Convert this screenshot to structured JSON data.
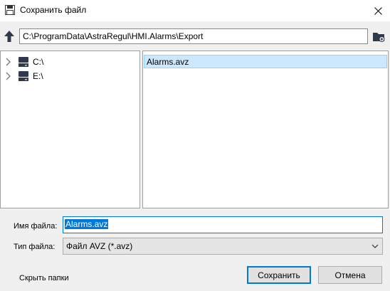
{
  "window": {
    "title": "Сохранить файл"
  },
  "path": {
    "value": "C:\\ProgramData\\AstraRegul\\HMI.Alarms\\Export"
  },
  "tree": {
    "items": [
      {
        "label": "C:\\"
      },
      {
        "label": "E:\\"
      }
    ]
  },
  "files": {
    "items": [
      {
        "name": "Alarms.avz",
        "selected": true
      }
    ]
  },
  "form": {
    "filename_label": "Имя файла:",
    "filename_value": "Alarms.avz",
    "filetype_label": "Тип файла:",
    "filetype_value": "Файл AVZ (*.avz)"
  },
  "footer": {
    "hide_folders_label": "Скрыть папки",
    "save_label": "Сохранить",
    "cancel_label": "Отмена"
  },
  "colors": {
    "accent": "#0078d7",
    "selection_bg": "#cce8ff"
  }
}
